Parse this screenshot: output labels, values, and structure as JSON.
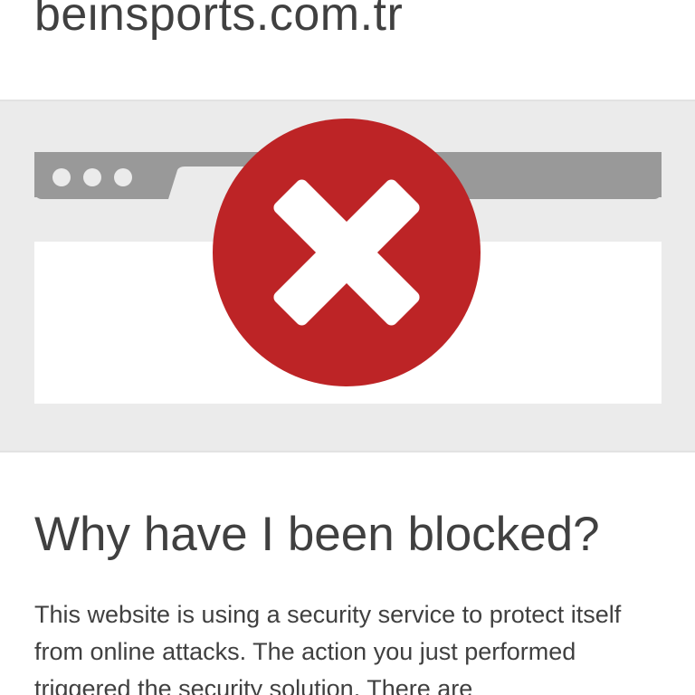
{
  "site": {
    "domain": "beinsports.com.tr"
  },
  "illustration": {
    "browser_icon": "browser-window-icon",
    "error_icon": "blocked-x-icon",
    "error_color": "#bd2426",
    "frame_color": "#999999",
    "content_color": "#ffffff",
    "band_color": "#ebebeb"
  },
  "main": {
    "heading": "Why have I been blocked?",
    "description": "This website is using a security service to protect itself from online attacks. The action you just performed triggered the security solution. There are"
  }
}
